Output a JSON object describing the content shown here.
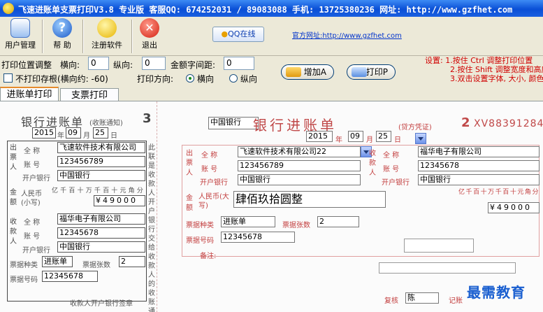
{
  "window": {
    "title": "飞速进账单支票打印V3.8 专业版 客服QQ: 674252031 / 89083088 手机: 13725380236 网址: http://www.gzfhet.com"
  },
  "toolbar": {
    "buttons": [
      "用户管理",
      "帮 助",
      "注册软件",
      "退出"
    ],
    "qq_button": "QQ在线",
    "website_link": "官方网址:http://www.gzfhet.com"
  },
  "controls": {
    "print_pos_label": "打印位置调整",
    "horizontal_label": "横向:",
    "horizontal_value": "0",
    "vertical_label": "纵向:",
    "vertical_value": "0",
    "amount_spacing_label": "金额字间距:",
    "amount_spacing_value": "0",
    "no_print_stub_label": "不打印存根(横向约: -60)",
    "direction_label": "打印方向:",
    "dir_horizontal": "横向",
    "dir_vertical": "纵向",
    "add_button": "增加A",
    "print_button": "打印P"
  },
  "settings_text": [
    "设置: 1.按住 Ctrl  调整打印位置",
    "2.按住 Shift 调整宽度和高度",
    "3.双击设置字体, 大小, 颜色"
  ],
  "tabs": [
    "进账单打印",
    "支票打印"
  ],
  "stub": {
    "title": "银行进账单",
    "subtitle": "(收账通知)",
    "number": "3",
    "year": "2015",
    "year_unit": "年",
    "month": "09",
    "month_unit": "月",
    "day": "25",
    "day_unit": "日",
    "payer_label": "出票人",
    "payee_label": "收款人",
    "name_label": "全  称",
    "account_label": "账  号",
    "bank_label": "开户银行",
    "payer_name": "飞速软件技术有限公司",
    "payer_account": "123456789",
    "payer_bank": "中国银行",
    "amount_label": "金额",
    "rmb_label": "人民币(小写)",
    "digit_headers": [
      "亿",
      "千",
      "百",
      "十",
      "万",
      "千",
      "百",
      "十",
      "元",
      "角",
      "分"
    ],
    "amount_digits": "¥49000",
    "payee_name": "福华电子有限公司",
    "payee_account": "12345678",
    "payee_bank": "中国银行",
    "bill_type_label": "票据种类",
    "bill_type": "进账单",
    "bill_count_label": "票据张数",
    "bill_count": "2",
    "bill_no_label": "票据号码",
    "bill_no": "12345678",
    "side_text": "此联是收款人开户银行交给收款人的收账通知",
    "bottom_label": "收款人开户银行签章"
  },
  "main": {
    "bank_name": "中国银行",
    "title": "银行进账单",
    "subtitle": "(贷方凭证)",
    "number": "2",
    "serial": "XV88391284",
    "year": "2015",
    "year_unit": "年",
    "month": "09",
    "month_unit": "月",
    "day": "25",
    "day_unit": "日",
    "payer_label": "出票人",
    "payee_label": "收款人",
    "name_label": "全  称",
    "account_label": "账  号",
    "bank_label": "开户银行",
    "payer_name": "飞速软件技术有限公司22",
    "payer_account": "123456789",
    "payer_bank": "中国银行",
    "payee_name": "福华电子有限公司",
    "payee_account": "12345678",
    "payee_bank": "中国银行",
    "amount_label": "金额",
    "rmb_label": "人民币(大写)",
    "amount_words": "肆佰玖拾圆整",
    "digit_headers": [
      "亿",
      "千",
      "百",
      "十",
      "万",
      "千",
      "百",
      "十",
      "元",
      "角",
      "分"
    ],
    "amount_digits": "¥49000",
    "bill_type_label": "票据种类",
    "bill_type": "进账单",
    "bill_count_label": "票据张数",
    "bill_count": "2",
    "bill_no_label": "票据号码",
    "bill_no": "12345678",
    "remark_label": "备注:",
    "review_label": "复核",
    "reviewer": "陈",
    "record_label": "记账"
  },
  "watermark": "最需教育"
}
